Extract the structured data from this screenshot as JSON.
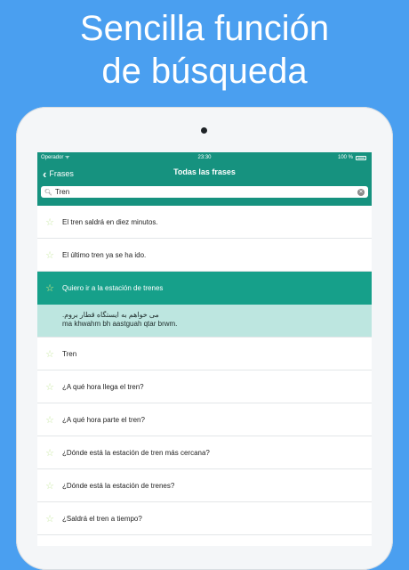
{
  "headline": {
    "line1": "Sencilla función",
    "line2": "de búsqueda"
  },
  "statusbar": {
    "carrier": "Operador",
    "time": "23:30",
    "battery": "100 %"
  },
  "navbar": {
    "back_label": "Frases",
    "title": "Todas las frases"
  },
  "search": {
    "value": "Tren"
  },
  "phrases": [
    "El tren saldrá en diez minutos.",
    "El último tren ya se ha ido.",
    "Quiero ir a la estación de trenes",
    "Tren",
    "¿A qué hora llega el tren?",
    "¿A qué hora parte el tren?",
    "¿Dónde está la estación de tren más cercana?",
    "¿Dónde está la estación de trenes?",
    "¿Saldrá el tren a tiempo?"
  ],
  "selected_detail": {
    "native": "می خواهم به ایستگاه قطار بروم.",
    "transliteration": "ma khwahm bh aastguah qtar brwm."
  },
  "colors": {
    "background": "#4a9ff0",
    "accent": "#16927f",
    "selected_row": "#16a08a",
    "detail_bg": "#bde6e0",
    "star": "#c9e9a5"
  },
  "icons": {
    "back": "chevron-left-icon",
    "search": "search-icon",
    "clear": "clear-icon",
    "favorite": "star-icon"
  }
}
